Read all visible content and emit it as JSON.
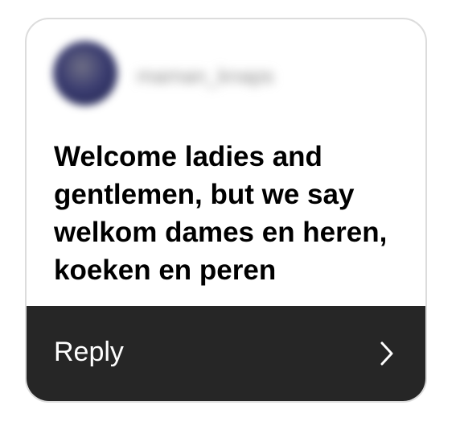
{
  "sender": {
    "username": "maman_knaps"
  },
  "message": {
    "text": "Welcome ladies and gentlemen, but we say welkom dames en heren, koeken en peren"
  },
  "actions": {
    "reply_label": "Reply",
    "reply_icon": "chevron-right-icon"
  }
}
